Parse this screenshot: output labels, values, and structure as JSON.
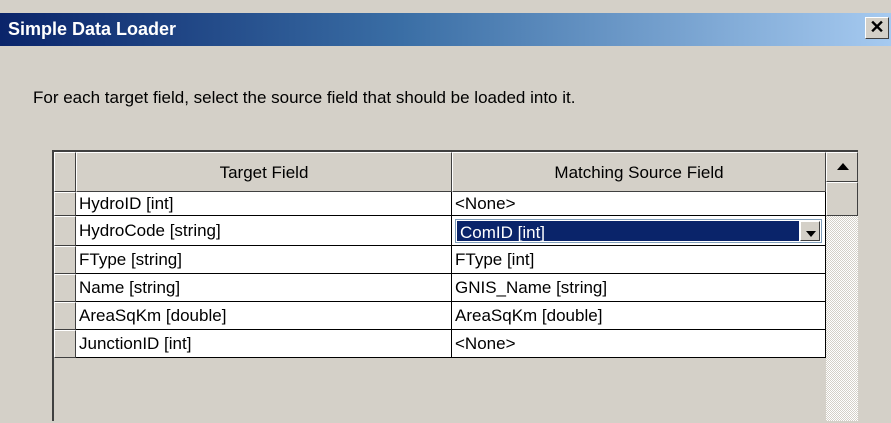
{
  "window": {
    "title": "Simple Data Loader",
    "close_glyph": "✕"
  },
  "instruction": "For each target field, select the source field that should be loaded into it.",
  "grid": {
    "columns": [
      "Target Field",
      "Matching Source Field"
    ],
    "rows": [
      {
        "target": "HydroID [int]",
        "source": "<None>"
      },
      {
        "target": "HydroCode [string]",
        "source": "ComID [int]"
      },
      {
        "target": "FType [string]",
        "source": "FType [int]"
      },
      {
        "target": "Name [string]",
        "source": "GNIS_Name [string]"
      },
      {
        "target": "AreaSqKm [double]",
        "source": "AreaSqKm [double]"
      },
      {
        "target": "JunctionID [int]",
        "source": "<None>"
      }
    ],
    "active_row_index": 1
  },
  "icons": {
    "close": "close-icon",
    "dropdown": "chevron-down-icon",
    "scroll_up": "scroll-up-arrow-icon"
  },
  "colors": {
    "titlebar_start": "#0a246a",
    "titlebar_end": "#a6caf0",
    "selection": "#0a246a",
    "dialog_bg": "#d4d0c8"
  }
}
